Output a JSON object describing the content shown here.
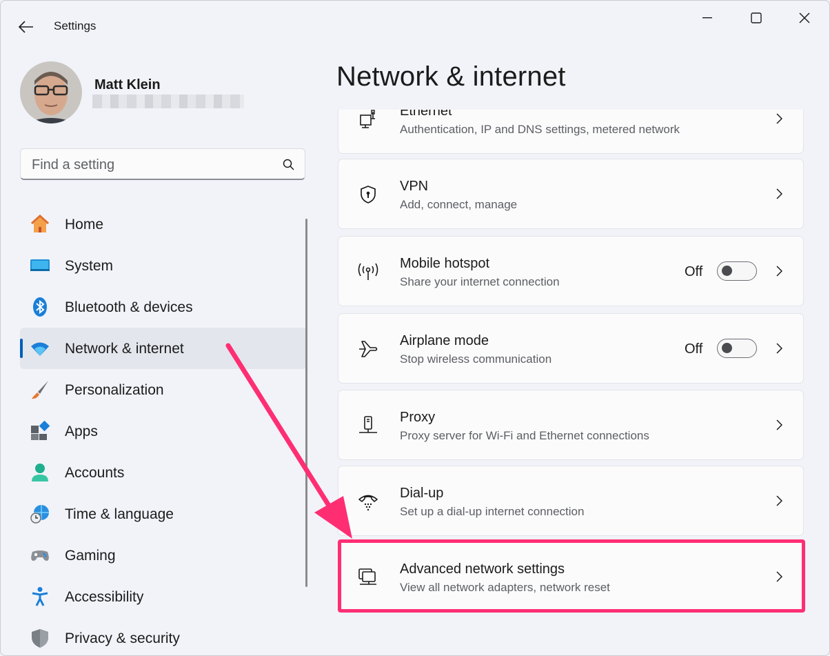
{
  "window": {
    "title": "Settings"
  },
  "profile": {
    "name": "Matt Klein"
  },
  "search": {
    "placeholder": "Find a setting"
  },
  "nav": {
    "items": [
      {
        "label": "Home",
        "icon": "home-icon"
      },
      {
        "label": "System",
        "icon": "system-icon"
      },
      {
        "label": "Bluetooth & devices",
        "icon": "bluetooth-icon"
      },
      {
        "label": "Network & internet",
        "icon": "wifi-icon",
        "active": true
      },
      {
        "label": "Personalization",
        "icon": "brush-icon"
      },
      {
        "label": "Apps",
        "icon": "apps-icon"
      },
      {
        "label": "Accounts",
        "icon": "accounts-icon"
      },
      {
        "label": "Time & language",
        "icon": "globe-clock-icon"
      },
      {
        "label": "Gaming",
        "icon": "gamepad-icon"
      },
      {
        "label": "Accessibility",
        "icon": "accessibility-icon"
      },
      {
        "label": "Privacy & security",
        "icon": "shield-icon"
      }
    ]
  },
  "main": {
    "title": "Network & internet",
    "cards": [
      {
        "title": "Ethernet",
        "desc": "Authentication, IP and DNS settings, metered network",
        "icon": "ethernet-icon"
      },
      {
        "title": "VPN",
        "desc": "Add, connect, manage",
        "icon": "vpn-shield-icon"
      },
      {
        "title": "Mobile hotspot",
        "desc": "Share your internet connection",
        "icon": "hotspot-icon",
        "toggle": "Off"
      },
      {
        "title": "Airplane mode",
        "desc": "Stop wireless communication",
        "icon": "airplane-icon",
        "toggle": "Off"
      },
      {
        "title": "Proxy",
        "desc": "Proxy server for Wi-Fi and Ethernet connections",
        "icon": "proxy-icon"
      },
      {
        "title": "Dial-up",
        "desc": "Set up a dial-up internet connection",
        "icon": "dialup-phone-icon"
      },
      {
        "title": "Advanced network settings",
        "desc": "View all network adapters, network reset",
        "icon": "advanced-network-icon",
        "highlighted": true
      }
    ]
  },
  "colors": {
    "accent": "#005fb8",
    "annotation": "#ff2e73"
  }
}
